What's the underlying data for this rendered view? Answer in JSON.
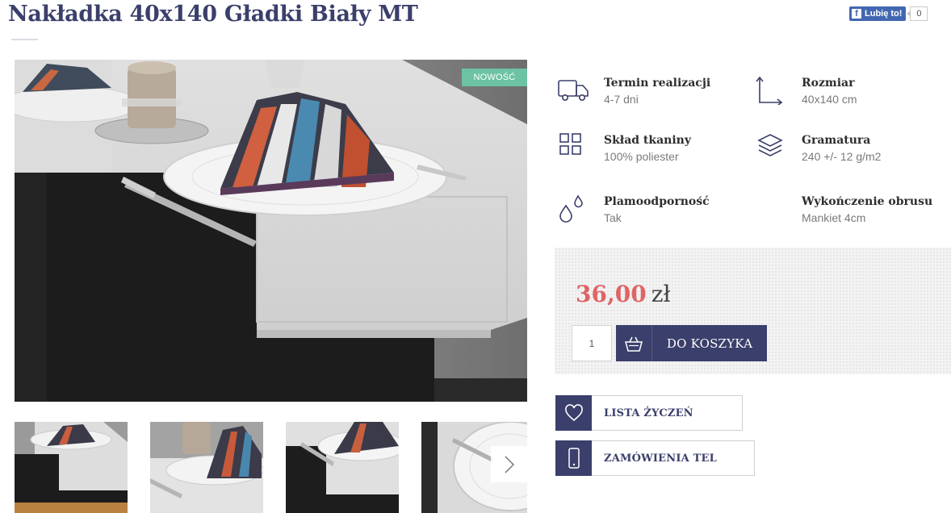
{
  "product": {
    "title": "Nakładka 40x140 Gładki Biały MT",
    "badge": "NOWOŚĆ"
  },
  "facebook": {
    "like_label": "Lubię to!",
    "count": "0"
  },
  "attributes": [
    {
      "label": "Termin realizacji",
      "value": "4-7 dni",
      "icon": "truck-icon"
    },
    {
      "label": "Rozmiar",
      "value": "40x140 cm",
      "icon": "dimensions-icon"
    },
    {
      "label": "Skład tkaniny",
      "value": "100% poliester",
      "icon": "grid-icon"
    },
    {
      "label": "Gramatura",
      "value": "240 +/- 12 g/m2",
      "icon": "layers-icon"
    },
    {
      "label": "Plamoodporność",
      "value": "Tak",
      "icon": "droplets-icon"
    },
    {
      "label": "Wykończenie obrusu",
      "value": "Mankiet 4cm",
      "icon": ""
    }
  ],
  "price": {
    "amount": "36,00",
    "currency": "zł"
  },
  "cart": {
    "quantity": "1",
    "button_label": "DO KOSZYKA"
  },
  "actions": {
    "wishlist_label": "LISTA ŻYCZEŃ",
    "phone_order_label": "ZAMÓWIENIA TEL"
  },
  "colors": {
    "brand": "#3b3f6b",
    "price": "#e06465",
    "badge": "#6cc3a4"
  }
}
